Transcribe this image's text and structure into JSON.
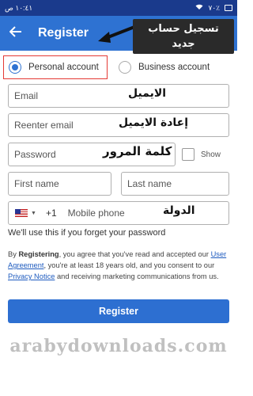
{
  "status_bar": {
    "time": "١٠:٤١ ص",
    "battery": "٧٠٪"
  },
  "header": {
    "title": "Register",
    "back_icon": "arrow-left-icon"
  },
  "callout": {
    "line1": "تسجيل حساب",
    "line2": "جديد"
  },
  "account_type": {
    "personal_label": "Personal account",
    "business_label": "Business account",
    "selected": "personal"
  },
  "form": {
    "email_placeholder": "Email",
    "reenter_email_placeholder": "Reenter email",
    "password_placeholder": "Password",
    "show_label": "Show",
    "first_name_placeholder": "First name",
    "last_name_placeholder": "Last name",
    "dial_code": "+1",
    "mobile_placeholder": "Mobile phone",
    "country_flag_icon": "us-flag-icon"
  },
  "annotations": {
    "email": "الايميل",
    "reenter_email": "إعادة الايميل",
    "password": "كلمة المرور",
    "country": "الدولة"
  },
  "hint": "We'll use this if you forget your password",
  "legal": {
    "by": "By ",
    "registering": "Registering",
    "text1": ", you agree that you've read and accepted our ",
    "user_agreement": "User Agreement",
    "text2": ", you're at least 18 years old, and you consent to our ",
    "privacy_notice": "Privacy Notice",
    "text3": " and receiving marketing communications from us."
  },
  "register_button": "Register",
  "watermark": "arabydownloads.com",
  "colors": {
    "app_bar": "#2e72d2",
    "status_bar": "#1a3a8c",
    "accent": "#2d6fd1",
    "highlight_border": "#e53935"
  }
}
